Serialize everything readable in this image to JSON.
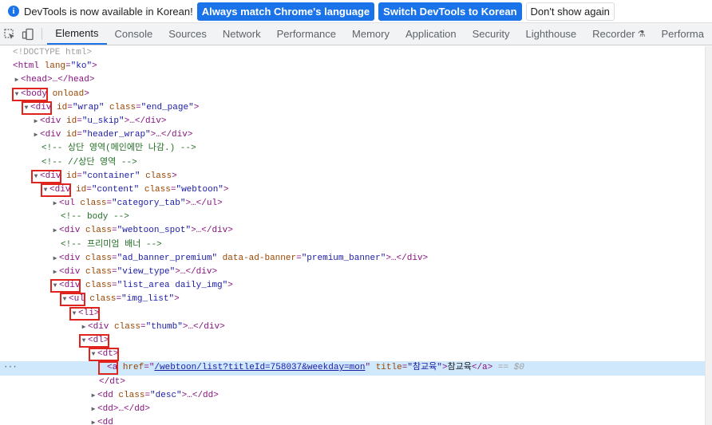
{
  "infobar": {
    "message": "DevTools is now available in Korean!",
    "btn_match": "Always match Chrome's language",
    "btn_switch": "Switch DevTools to Korean",
    "btn_dismiss": "Don't show again"
  },
  "tabs": [
    "Elements",
    "Console",
    "Sources",
    "Network",
    "Performance",
    "Memory",
    "Application",
    "Security",
    "Lighthouse",
    "Recorder",
    "Performa"
  ],
  "tree": {
    "doctype": "<!DOCTYPE html>",
    "html_open": "<html",
    "lang_attr": "lang",
    "lang_val": "\"ko\"",
    "gt": ">",
    "head": "<head>…</head>",
    "body_tag": "<body",
    "body_attr": "onload",
    "div_tag": "<div",
    "id_attr": "id",
    "class_attr": "class",
    "wrap_val": "\"wrap\"",
    "end_page_val": "\"end_page\"",
    "u_skip_val": "\"u_skip\"",
    "header_wrap_val": "\"header_wrap\"",
    "div_close_collapsed": ">…</div>",
    "comment1": "<!-- 상단 영역(메인에만 나감.) -->",
    "comment2": "<!-- //상단 영역 -->",
    "container_val": "\"container\"",
    "content_val": "\"content\"",
    "webtoon_val": "\"webtoon\"",
    "ul_tag": "<ul",
    "category_tab_val": "\"category_tab\"",
    "ul_close_collapsed": ">…</ul>",
    "comment3": "<!-- body -->",
    "webtoon_spot_val": "\"webtoon_spot\"",
    "comment4": "<!-- 프리미엄 배너 -->",
    "ad_banner_val": "\"ad_banner_premium\"",
    "data_ad_attr": "data-ad-banner",
    "premium_banner_val": "\"premium_banner\"",
    "view_type_val": "\"view_type\"",
    "list_area_val": "\"list_area daily_img\"",
    "img_list_val": "\"img_list\"",
    "li_tag": "<li>",
    "thumb_val": "\"thumb\"",
    "dl_tag": "<dl>",
    "dt_tag": "<dt>",
    "a_tag": "<a",
    "href_attr": "href",
    "href_val": "/webtoon/list?titleId=758037&weekday=mon",
    "title_attr": "title",
    "title_val": "\"참교육\"",
    "a_text": "참교육",
    "a_close": "</a>",
    "eq0": "== $0",
    "dt_close": "</dt>",
    "dd_tag": "<dd",
    "desc_val": "\"desc\"",
    "dd_close_collapsed": ">…</dd>",
    "dd_empty": "<dd>…</dd>",
    "ellipsis": "···"
  },
  "colors": {
    "accent": "#1a73e8",
    "selection": "#cfe8fc",
    "highlight_box": "#e0231c",
    "tag": "#881280",
    "attr": "#994500",
    "value": "#1a1aa6",
    "comment": "#236e25"
  },
  "icons": [
    "info-icon",
    "inspect-element-icon",
    "device-toolbar-icon",
    "flask-icon",
    "expand-triangle-icon",
    "collapse-triangle-icon"
  ]
}
